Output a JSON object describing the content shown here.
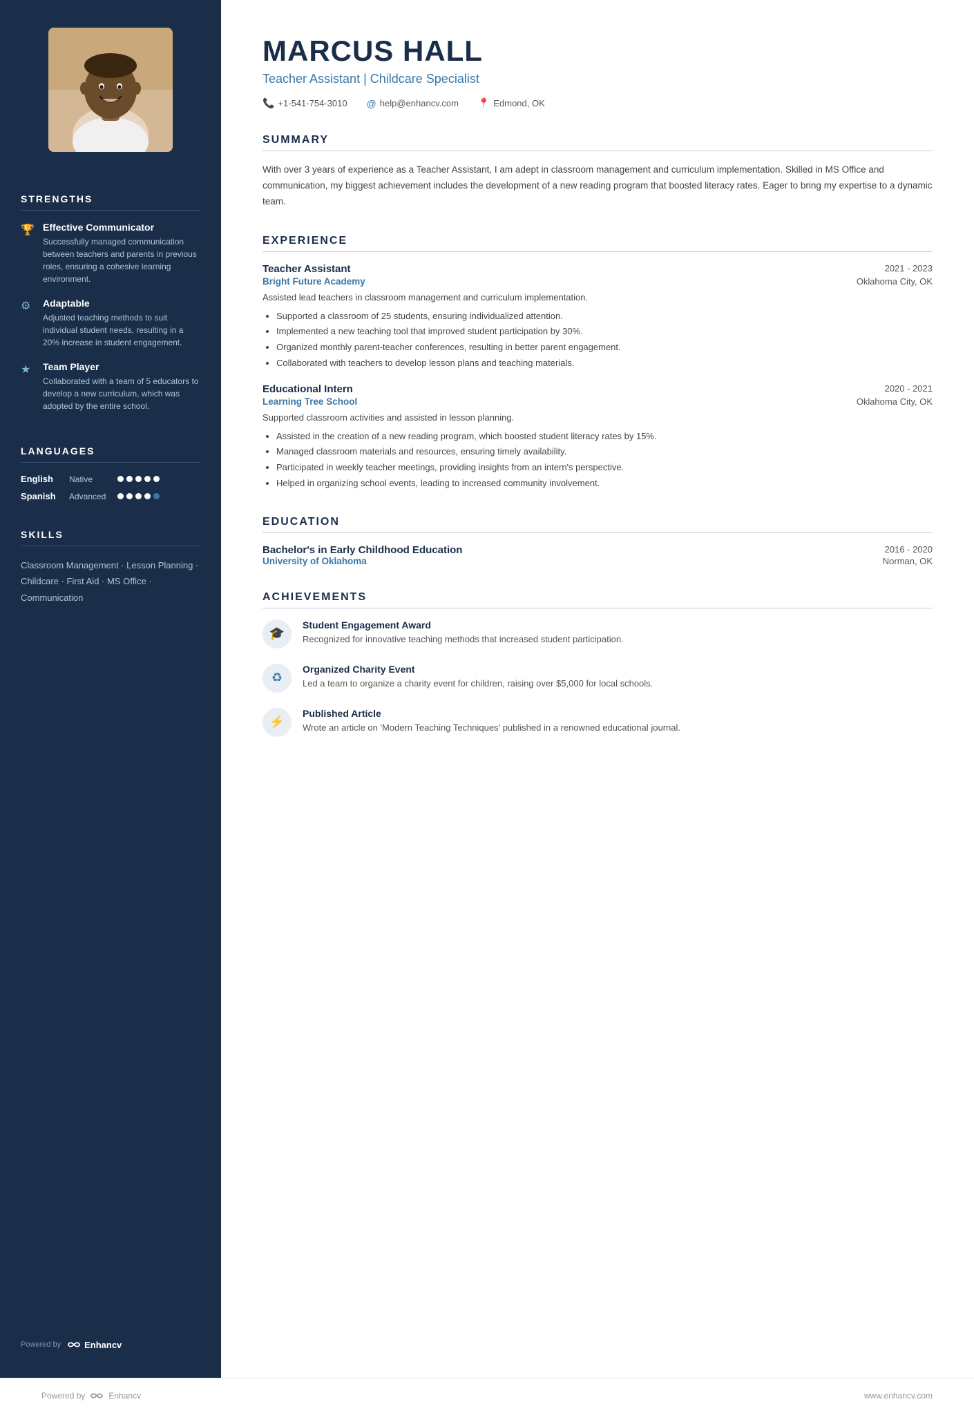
{
  "sidebar": {
    "strengths_title": "STRENGTHS",
    "strengths": [
      {
        "icon": "🏆",
        "title": "Effective Communicator",
        "desc": "Successfully managed communication between teachers and parents in previous roles, ensuring a cohesive learning environment."
      },
      {
        "icon": "⚙",
        "title": "Adaptable",
        "desc": "Adjusted teaching methods to suit individual student needs, resulting in a 20% increase in student engagement."
      },
      {
        "icon": "★",
        "title": "Team Player",
        "desc": "Collaborated with a team of 5 educators to develop a new curriculum, which was adopted by the entire school."
      }
    ],
    "languages_title": "LANGUAGES",
    "languages": [
      {
        "name": "English",
        "level": "Native",
        "filled": 5,
        "total": 5
      },
      {
        "name": "Spanish",
        "level": "Advanced",
        "filled": 4,
        "total": 5
      }
    ],
    "skills_title": "SKILLS",
    "skills_text": "Classroom Management · Lesson Planning · Childcare · First Aid · MS Office · Communication",
    "footer_powered": "Powered by",
    "footer_brand": "Enhancv"
  },
  "header": {
    "name": "MARCUS HALL",
    "title": "Teacher Assistant | Childcare Specialist",
    "phone": "+1-541-754-3010",
    "email": "help@enhancv.com",
    "location": "Edmond, OK"
  },
  "summary": {
    "title": "SUMMARY",
    "text": "With over 3 years of experience as a Teacher Assistant, I am adept in classroom management and curriculum implementation. Skilled in MS Office and communication, my biggest achievement includes the development of a new reading program that boosted literacy rates. Eager to bring my expertise to a dynamic team."
  },
  "experience": {
    "title": "EXPERIENCE",
    "jobs": [
      {
        "job_title": "Teacher Assistant",
        "dates": "2021 - 2023",
        "company": "Bright Future Academy",
        "location": "Oklahoma City, OK",
        "desc": "Assisted lead teachers in classroom management and curriculum implementation.",
        "bullets": [
          "Supported a classroom of 25 students, ensuring individualized attention.",
          "Implemented a new teaching tool that improved student participation by 30%.",
          "Organized monthly parent-teacher conferences, resulting in better parent engagement.",
          "Collaborated with teachers to develop lesson plans and teaching materials."
        ]
      },
      {
        "job_title": "Educational Intern",
        "dates": "2020 - 2021",
        "company": "Learning Tree School",
        "location": "Oklahoma City, OK",
        "desc": "Supported classroom activities and assisted in lesson planning.",
        "bullets": [
          "Assisted in the creation of a new reading program, which boosted student literacy rates by 15%.",
          "Managed classroom materials and resources, ensuring timely availability.",
          "Participated in weekly teacher meetings, providing insights from an intern's perspective.",
          "Helped in organizing school events, leading to increased community involvement."
        ]
      }
    ]
  },
  "education": {
    "title": "EDUCATION",
    "entries": [
      {
        "degree": "Bachelor's in Early Childhood Education",
        "dates": "2016 - 2020",
        "school": "University of Oklahoma",
        "location": "Norman, OK"
      }
    ]
  },
  "achievements": {
    "title": "ACHIEVEMENTS",
    "items": [
      {
        "icon": "🎓",
        "title": "Student Engagement Award",
        "desc": "Recognized for innovative teaching methods that increased student participation."
      },
      {
        "icon": "♻",
        "title": "Organized Charity Event",
        "desc": "Led a team to organize a charity event for children, raising over $5,000 for local schools."
      },
      {
        "icon": "⚡",
        "title": "Published Article",
        "desc": "Wrote an article on 'Modern Teaching Techniques' published in a renowned educational journal."
      }
    ]
  },
  "footer": {
    "powered_by": "Powered by",
    "brand": "Enhancv",
    "website": "www.enhancv.com"
  }
}
